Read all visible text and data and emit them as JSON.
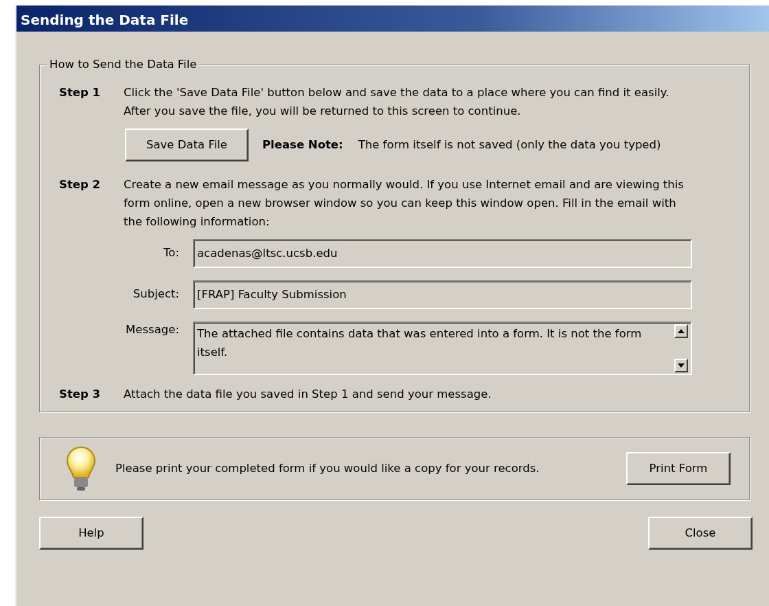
{
  "window": {
    "title": "Sending the Data File"
  },
  "group": {
    "legend": "How to Send the Data File",
    "steps": [
      {
        "label": "Step 1",
        "text": "Click the 'Save Data File' button below and save the data to a place where you can find it easily. After you save the file, you will be returned to this screen to continue."
      },
      {
        "label": "Step 2",
        "text": "Create a new email message as you normally would.  If you use Internet email and are viewing this form online, open a new browser window so you can keep this window open. Fill in the email with the following information:"
      },
      {
        "label": "Step 3",
        "text": "Attach the data file you saved in Step 1 and send your message."
      }
    ],
    "save_button": "Save Data File",
    "note_label": "Please Note:",
    "note_text": "The form itself is not saved (only the data you typed)",
    "fields": [
      {
        "label": "To:",
        "value": "acadenas@ltsc.ucsb.edu",
        "kind": "line"
      },
      {
        "label": "Subject:",
        "value": "[FRAP] Faculty Submission",
        "kind": "line"
      },
      {
        "label": "Message:",
        "value": "The attached file contains data that was entered into a form. It is not the form itself.",
        "kind": "area"
      }
    ]
  },
  "tip": {
    "text": "Please print your completed form if you would like a copy for your records.",
    "button": "Print Form"
  },
  "buttons": [
    "Help",
    "Close"
  ]
}
